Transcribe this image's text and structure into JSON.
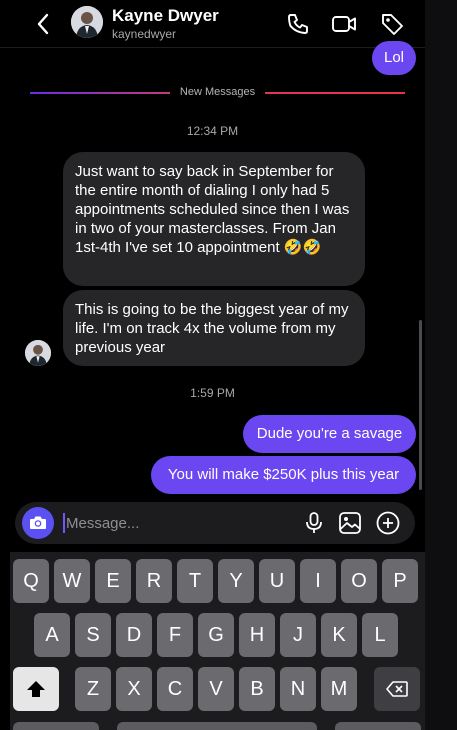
{
  "header": {
    "contact_name": "Kayne Dwyer",
    "contact_handle": "kaynedwyer"
  },
  "conversation": {
    "earlier_outgoing": "Lol",
    "new_messages_label": "New Messages",
    "timestamp_1": "12:34 PM",
    "incoming": [
      "Just want to say back in September for the entire month of dialing I only had 5 appointments scheduled since then I was in two of your masterclasses. From Jan 1st-4th I've set 10 appointment 🤣🤣",
      "This is going to be the biggest year of my life. I'm on track 4x the volume from my previous year"
    ],
    "timestamp_2": "1:59 PM",
    "outgoing": [
      "Dude you're a savage",
      "You will make $250K plus this year"
    ]
  },
  "composer": {
    "placeholder": "Message...",
    "icons": [
      "camera-icon",
      "microphone-icon",
      "gallery-icon",
      "plus-icon"
    ]
  },
  "keyboard": {
    "row1": [
      "Q",
      "W",
      "E",
      "R",
      "T",
      "Y",
      "U",
      "I",
      "O",
      "P"
    ],
    "row2": [
      "A",
      "S",
      "D",
      "F",
      "G",
      "H",
      "J",
      "K",
      "L"
    ],
    "row3": [
      "Z",
      "X",
      "C",
      "V",
      "B",
      "N",
      "M"
    ]
  },
  "colors": {
    "outgoing_bubble": "#6a47f0",
    "incoming_bubble": "#262628",
    "background": "#000000",
    "accent": "#5b51f2"
  }
}
